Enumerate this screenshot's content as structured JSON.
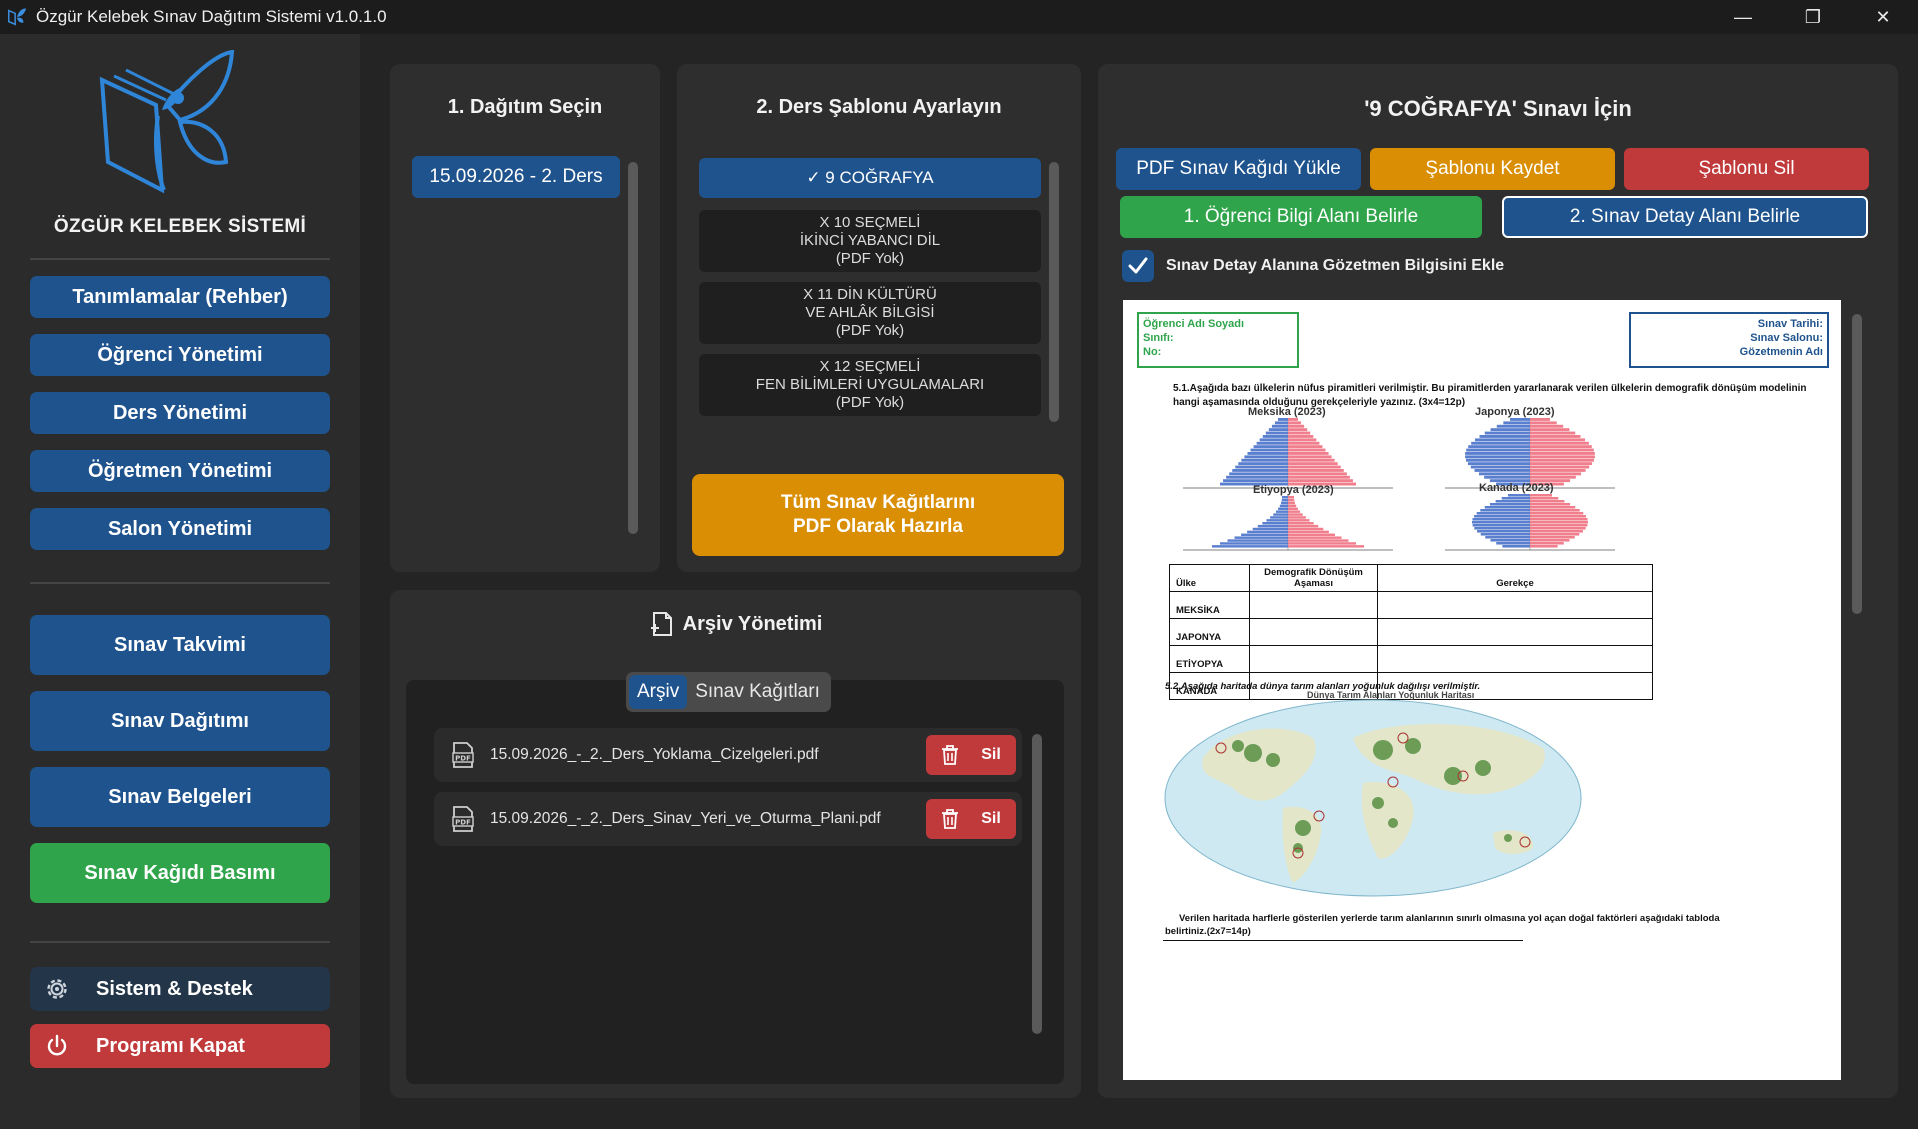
{
  "window": {
    "title": "Özgür Kelebek Sınav Dağıtım Sistemi v1.0.1.0",
    "minimize_glyph": "—",
    "maximize_glyph": "❐",
    "close_glyph": "✕"
  },
  "sidebar": {
    "brand": "ÖZGÜR KELEBEK SİSTEMİ",
    "group1": [
      "Tanımlamalar (Rehber)",
      "Öğrenci Yönetimi",
      "Ders Yönetimi",
      "Öğretmen Yönetimi",
      "Salon Yönetimi"
    ],
    "group2": [
      "Sınav Takvimi",
      "Sınav Dağıtımı",
      "Sınav Belgeleri",
      "Sınav Kağıdı Basımı"
    ],
    "system_label": "Sistem & Destek",
    "exit_label": "Programı Kapat"
  },
  "distribution": {
    "title": "1. Dağıtım Seçin",
    "items": [
      "15.09.2026 - 2. Ders"
    ]
  },
  "templates": {
    "title": "2. Ders Şablonu Ayarlayın",
    "items": [
      {
        "lines": [
          "✓ 9 COĞRAFYA"
        ]
      },
      {
        "lines": [
          "X 10 SEÇMELİ",
          "İKİNCİ YABANCI DİL",
          "(PDF Yok)"
        ]
      },
      {
        "lines": [
          "X 11 DİN KÜLTÜRÜ",
          "VE AHLÂK BİLGİSİ",
          "(PDF Yok)"
        ]
      },
      {
        "lines": [
          "X 12 SEÇMELİ",
          "FEN BİLİMLERİ UYGULAMALARI",
          "(PDF Yok)"
        ]
      }
    ],
    "prepare_line1": "Tüm Sınav Kağıtlarını",
    "prepare_line2": "PDF Olarak Hazırla"
  },
  "archive": {
    "title": "Arşiv Yönetimi",
    "tabs": [
      "Arşiv",
      "Sınav Kağıtları"
    ],
    "files": [
      "15.09.2026_-_2._Ders_Yoklama_Cizelgeleri.pdf",
      "15.09.2026_-_2._Ders_Sinav_Yeri_ve_Oturma_Plani.pdf"
    ],
    "delete_label": "Sil"
  },
  "exam": {
    "title": "'9 COĞRAFYA' Sınavı İçin",
    "upload_label": "PDF Sınav Kağıdı Yükle",
    "save_label": "Şablonu Kaydet",
    "delete_label": "Şablonu Sil",
    "student_area_label": "1. Öğrenci Bilgi Alanı Belirle",
    "detail_area_label": "2. Sınav Detay Alanı Belirle",
    "checkbox_label": "Sınav Detay Alanına Gözetmen Bilgisini Ekle",
    "checkbox_checked": true
  },
  "paper": {
    "student_box": [
      "Öğrenci Adı Soyadı",
      "Sınıfı:",
      "No:"
    ],
    "detail_box": [
      "Sınav Tarihi:",
      "Sınav Salonu:",
      "Gözetmenin Adı"
    ],
    "q1_line1": "5.1.Aşağıda bazı ülkelerin nüfus piramitleri verilmiştir. Bu piramitlerden yararlanarak verilen ülkelerin demografik dönüşüm modelinin",
    "q1_line2": "hangi aşamasında olduğunu gerekçeleriyle yazınız. (3x4=12p)",
    "pyramids": [
      "Meksika (2023)",
      "Japonya (2023)",
      "Etiyopya (2023)",
      "Kanada (2023)"
    ],
    "table_headers": [
      "Ülke",
      "Demografik Dönüşüm Aşaması",
      "Gerekçe"
    ],
    "table_rows": [
      "MEKSİKA",
      "JAPONYA",
      "ETİYOPYA",
      "KANADA"
    ],
    "q2_line": "5.2.Aşağıda haritada dünya tarım alanları yoğunluk dağılışı verilmiştir.",
    "map_title": "Dünya Tarım Alanları Yoğunluk Haritası",
    "q3_line1": "Verilen haritada harflerle gösterilen yerlerde tarım alanlarının sınırlı olmasına yol açan doğal faktörleri aşağıdaki tabloda",
    "q3_line2": "belirtiniz.(2x7=14p)"
  },
  "colors": {
    "blue": "#1f538d",
    "orange": "#d98e04",
    "red": "#c0393b",
    "green": "#2fa44b",
    "male": "#5b7fcf",
    "female": "#f07e8c"
  }
}
